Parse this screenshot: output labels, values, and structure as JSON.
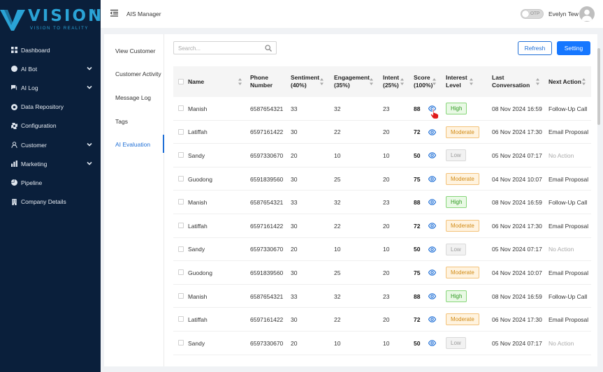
{
  "brand": {
    "name": "VISION",
    "trademark": "TM",
    "tagline": "VISION TO REALITY",
    "color": "#2aa3d6",
    "icon": "vision-logo-icon"
  },
  "sidebar": {
    "background": "#0a1f3b",
    "items": [
      {
        "label": "Dashboard",
        "icon": "grid-icon",
        "expandable": false
      },
      {
        "label": "AI Bot",
        "icon": "bot-icon",
        "expandable": true
      },
      {
        "label": "AI Log",
        "icon": "chat-icon",
        "expandable": true
      },
      {
        "label": "Data Repository",
        "icon": "database-icon",
        "expandable": false
      },
      {
        "label": "Configuration",
        "icon": "gear-icon",
        "expandable": false
      },
      {
        "label": "Customer",
        "icon": "user-icon",
        "expandable": true
      },
      {
        "label": "Marketing",
        "icon": "bar-chart-icon",
        "expandable": true
      },
      {
        "label": "Pipeline",
        "icon": "pie-chart-icon",
        "expandable": false
      },
      {
        "label": "Company Details",
        "icon": "building-icon",
        "expandable": false
      }
    ]
  },
  "topbar": {
    "menu_icon": "menu-toggle-icon",
    "title": "AIS Manager",
    "toggle_label": "OTP",
    "toggle_on": false,
    "user_name": "Evelyn Tew",
    "avatar_icon": "avatar-icon"
  },
  "subnav": {
    "items": [
      "View Customer",
      "Customer Activity",
      "Message Log",
      "Tags",
      "AI Evaluation"
    ],
    "active": "AI Evaluation"
  },
  "toolbar": {
    "search_placeholder": "Search...",
    "search_icon": "search-icon",
    "refresh_label": "Refresh",
    "setting_label": "Setting"
  },
  "table": {
    "headers": {
      "name": "Name",
      "phone": [
        "Phone",
        "Number"
      ],
      "sentiment": [
        "Sentiment",
        "(40%)"
      ],
      "engagement": [
        "Engagement",
        "(35%)"
      ],
      "intent": [
        "Intent",
        "(25%)"
      ],
      "score": [
        "Score",
        "(100%)"
      ],
      "interest": [
        "Interest",
        "Level"
      ],
      "last": [
        "Last",
        "Conversation"
      ],
      "next": "Next Action"
    },
    "rows": [
      {
        "name": "Manish",
        "phone": "6587654321",
        "sentiment": "33",
        "engagement": "32",
        "intent": "23",
        "score": "88",
        "interest": "High",
        "last": "08 Nov 2024 16:59",
        "next": "Follow-Up Call"
      },
      {
        "name": "Latiffah",
        "phone": "6597161422",
        "sentiment": "30",
        "engagement": "22",
        "intent": "20",
        "score": "72",
        "interest": "Moderate",
        "last": "06 Nov 2024 17:30",
        "next": "Email Proposal"
      },
      {
        "name": "Sandy",
        "phone": "6597330670",
        "sentiment": "20",
        "engagement": "10",
        "intent": "10",
        "score": "50",
        "interest": "Low",
        "last": "05 Nov 2024 07:17",
        "next": "No Action"
      },
      {
        "name": "Guodong",
        "phone": "6591839560",
        "sentiment": "30",
        "engagement": "25",
        "intent": "20",
        "score": "75",
        "interest": "Moderate",
        "last": "04 Nov 2024 10:07",
        "next": "Email Proposal"
      },
      {
        "name": "Manish",
        "phone": "6587654321",
        "sentiment": "33",
        "engagement": "32",
        "intent": "23",
        "score": "88",
        "interest": "High",
        "last": "08 Nov 2024 16:59",
        "next": "Follow-Up Call"
      },
      {
        "name": "Latiffah",
        "phone": "6597161422",
        "sentiment": "30",
        "engagement": "22",
        "intent": "20",
        "score": "72",
        "interest": "Moderate",
        "last": "06 Nov 2024 17:30",
        "next": "Email Proposal"
      },
      {
        "name": "Sandy",
        "phone": "6597330670",
        "sentiment": "20",
        "engagement": "10",
        "intent": "10",
        "score": "50",
        "interest": "Low",
        "last": "05 Nov 2024 07:17",
        "next": "No Action"
      },
      {
        "name": "Guodong",
        "phone": "6591839560",
        "sentiment": "30",
        "engagement": "25",
        "intent": "20",
        "score": "75",
        "interest": "Moderate",
        "last": "04 Nov 2024 10:07",
        "next": "Email Proposal"
      },
      {
        "name": "Manish",
        "phone": "6587654321",
        "sentiment": "33",
        "engagement": "32",
        "intent": "23",
        "score": "88",
        "interest": "High",
        "last": "08 Nov 2024 16:59",
        "next": "Follow-Up Call"
      },
      {
        "name": "Latiffah",
        "phone": "6597161422",
        "sentiment": "30",
        "engagement": "22",
        "intent": "20",
        "score": "72",
        "interest": "Moderate",
        "last": "06 Nov 2024 17:30",
        "next": "Email Proposal"
      },
      {
        "name": "Sandy",
        "phone": "6597330670",
        "sentiment": "20",
        "engagement": "10",
        "intent": "10",
        "score": "50",
        "interest": "Low",
        "last": "05 Nov 2024 07:17",
        "next": "No Action"
      }
    ]
  },
  "colors": {
    "primary": "#1677ff",
    "high": "#2f9a21",
    "moderate": "#d18b16",
    "low": "#9a9a9a"
  }
}
